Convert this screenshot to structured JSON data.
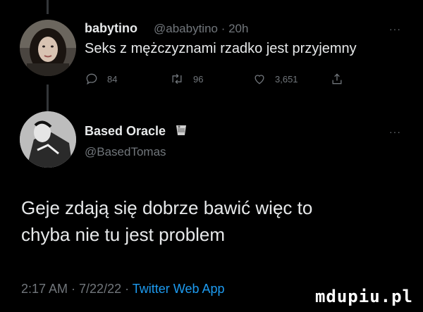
{
  "reply_tweet": {
    "display_name": "babytino",
    "handle_time": "@ababytino · 20h",
    "text": "Seks z mężczyznami rzadko jest przyjemny",
    "more": "···",
    "actions": {
      "replies": "84",
      "retweets": "96",
      "likes": "3,651"
    }
  },
  "main_tweet": {
    "display_name": "Based Oracle",
    "handle": "@BasedTomas",
    "more": "···",
    "text_line1": "Geje zdają się dobrze bawić więc to",
    "text_line2": "chyba nie tu jest problem",
    "timestamp": "2:17 AM · 7/22/22 · ",
    "source": "Twitter Web App"
  },
  "watermark": "mdupiu.pl",
  "colors": {
    "background": "#000000",
    "text": "#e7e9ea",
    "secondary": "#71767b",
    "link": "#1d9bf0"
  }
}
